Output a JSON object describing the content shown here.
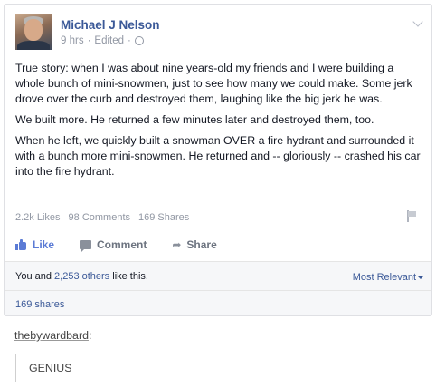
{
  "post": {
    "author": "Michael J Nelson",
    "time": "9 hrs",
    "edited": "Edited",
    "separator": "·",
    "paragraphs": [
      "True story: when I was about nine years-old my friends and I were building a whole bunch of mini-snowmen, just to see how many we could make. Some jerk drove over the curb and destroyed them, laughing like the big jerk he was.",
      "We built more. He returned a few minutes later and destroyed them, too.",
      "When he left, we quickly built a snowman OVER a fire hydrant and surrounded it with a bunch more mini-snowmen. He returned and -- gloriously -- crashed his car into the fire hydrant."
    ],
    "stats": {
      "likes": "2.2k Likes",
      "comments": "98 Comments",
      "shares": "169 Shares"
    },
    "actions": {
      "like": "Like",
      "comment": "Comment",
      "share": "Share"
    },
    "likes_summary": {
      "prefix": "You and ",
      "link": "2,253 others",
      "suffix": " like this."
    },
    "sort_label": "Most Relevant",
    "shares_link": "169 shares"
  },
  "tumblr": {
    "username": "thebywardbard",
    "colon": ":",
    "reply": "GENIUS"
  },
  "colors": {
    "facebook_blue": "#3b5998",
    "like_blue": "#5b7bd5",
    "muted_gray": "#9197a3"
  },
  "icons": [
    "globe-icon",
    "chevron-down-icon",
    "thumb-icon",
    "comment-icon",
    "share-icon",
    "flag-icon",
    "caret-icon"
  ]
}
